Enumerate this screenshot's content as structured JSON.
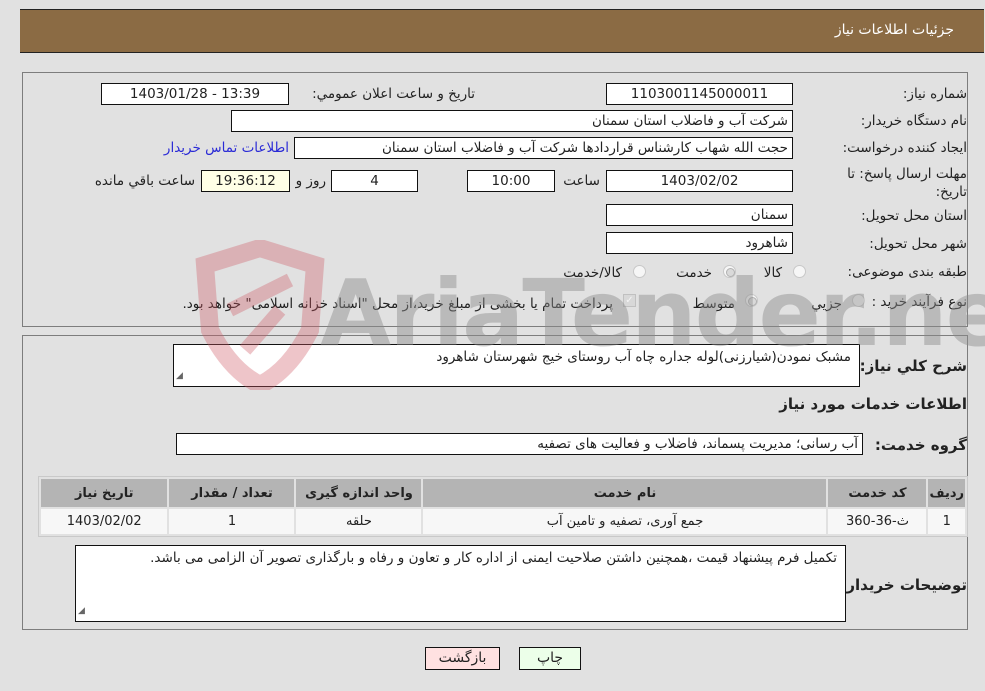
{
  "header": {
    "title": "جزئیات اطلاعات نیاز"
  },
  "fields": {
    "need_number_label": "شماره نیاز:",
    "need_number": "1103001145000011",
    "announce_label": "تاریخ و ساعت اعلان عمومي:",
    "announce_value": "1403/01/28 - 13:39",
    "buyer_org_label": "نام دستگاه خریدار:",
    "buyer_org": "شرکت آب و فاضلاب استان سمنان",
    "creator_label": "ایجاد کننده درخواست:",
    "creator": "حجت الله شهاب کارشناس قراردادها شرکت آب و فاضلاب استان سمنان",
    "contact_link": "اطلاعات تماس خریدار",
    "deadline_label": "مهلت ارسال پاسخ: تا تاریخ:",
    "deadline_date": "1403/02/02",
    "time_label": "ساعت",
    "deadline_time": "10:00",
    "days_value": "4",
    "days_label": "روز و",
    "remaining_time": "19:36:12",
    "remaining_label": "ساعت باقي مانده",
    "province_label": "استان محل تحویل:",
    "province": "سمنان",
    "city_label": "شهر محل تحویل:",
    "city": "شاهرود",
    "category_label": "طبقه بندی موضوعی:",
    "category_options": [
      {
        "label": "کالا",
        "selected": false
      },
      {
        "label": "خدمت",
        "selected": true
      },
      {
        "label": "کالا/خدمت",
        "selected": false
      }
    ],
    "process_label": "نوع فرآیند خرید :",
    "process_options": [
      {
        "label": "جزيي",
        "selected": false
      },
      {
        "label": "متوسط",
        "selected": true
      }
    ],
    "treasury_checked": true,
    "treasury_text": "پرداخت تمام یا بخشی از مبلغ خرید،از محل \"اسناد خزانه اسلامی\" خواهد بود."
  },
  "details": {
    "description_label": "شرح کلي نیاز:",
    "description": "مشبک نمودن(شیارزنی)لوله جداره چاه آب روستای خیج شهرستان شاهرود",
    "services_heading": "اطلاعات خدمات مورد نیاز",
    "service_group_label": "گروه خدمت:",
    "service_group": "آب رسانی؛ مدیریت پسماند، فاضلاب و فعالیت های تصفیه",
    "table": {
      "headers": [
        "ردیف",
        "کد خدمت",
        "نام خدمت",
        "واحد اندازه گیری",
        "تعداد / مقدار",
        "تاریخ نیاز"
      ],
      "rows": [
        [
          "1",
          "ث-36-360",
          "جمع آوری، تصفیه و تامین آب",
          "حلقه",
          "1",
          "1403/02/02"
        ]
      ]
    },
    "buyer_notes_label": "توضیحات خریدار:",
    "buyer_notes": "تکمیل فرم پیشنهاد قیمت ،همچنین داشتن صلاحیت ایمنی از اداره کار و تعاون و رفاه و بارگذاری تصویر آن الزامی می باشد."
  },
  "buttons": {
    "print": "چاپ",
    "back": "بازگشت"
  },
  "watermark": {
    "text": "AriaTender.neT"
  },
  "colors": {
    "header": "#8b6b44",
    "print_bg": "#ecffe9",
    "back_bg": "#ffe1e1",
    "link": "#2b2bd6"
  }
}
